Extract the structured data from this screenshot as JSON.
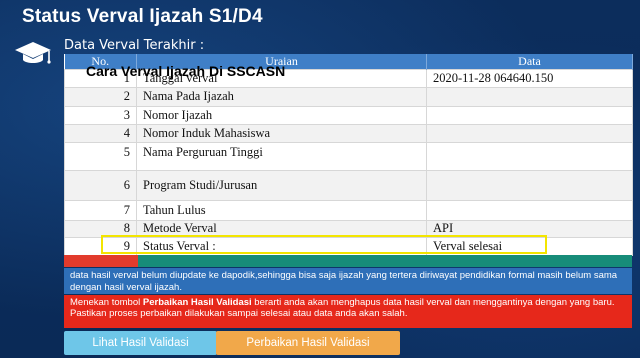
{
  "page": {
    "title": "Status Verval Ijazah S1/D4",
    "subtitle": "Data Verval Terakhir :",
    "watermark": "Cara Verval Ijazah Di SSCASN"
  },
  "table": {
    "headers": [
      "No.",
      "Uraian",
      "Data"
    ],
    "rows": [
      {
        "no": "1",
        "uraian": "Tanggal verval",
        "data": "2020-11-28 064640.150"
      },
      {
        "no": "2",
        "uraian": "Nama Pada Ijazah",
        "data": ""
      },
      {
        "no": "3",
        "uraian": "Nomor Ijazah",
        "data": ""
      },
      {
        "no": "4",
        "uraian": "Nomor Induk Mahasiswa",
        "data": ""
      },
      {
        "no": "5",
        "uraian": "Nama Perguruan Tinggi",
        "data": ""
      },
      {
        "no": "6",
        "uraian": "Program Studi/Jurusan",
        "data": ""
      },
      {
        "no": "7",
        "uraian": "Tahun Lulus",
        "data": ""
      },
      {
        "no": "8",
        "uraian": "Metode Verval",
        "data": "API"
      },
      {
        "no": "9",
        "uraian": "Status Verval :",
        "data": "Verval selesai"
      }
    ]
  },
  "info_text": "data hasil verval belum diupdate ke dapodik,sehingga bisa saja ijazah yang tertera diriwayat pendidikan formal masih belum sama dengan hasil verval ijazah.",
  "warning": {
    "prefix": "Menekan tombol ",
    "emphasis": "Perbaikan Hasil Validasi",
    "suffix": " berarti anda akan menghapus data hasil verval dan menggantinya dengan yang baru. Pastikan proses perbaikan dilakukan sampai selesai atau data anda akan salah."
  },
  "buttons": {
    "lihat": "Lihat Hasil Validasi",
    "perbaikan": "Perbaikan Hasil Validasi"
  },
  "colors": {
    "background": "#0b2a55",
    "table_header": "#3f7fc7",
    "info_box": "#2e6fb8",
    "warning_box": "#e6281b",
    "highlight": "#f3e500",
    "button_lihat": "#6ec6e8",
    "button_perbaikan": "#f1a84a"
  }
}
